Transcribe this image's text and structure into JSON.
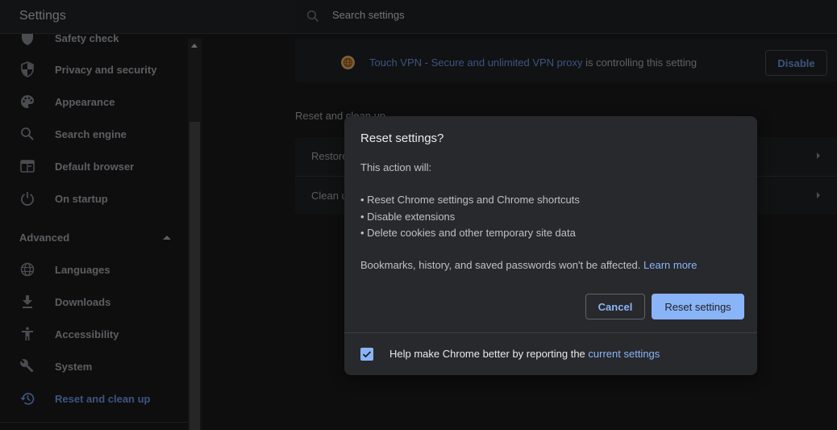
{
  "header": {
    "title": "Settings",
    "search_placeholder": "Search settings"
  },
  "sidebar": {
    "items": [
      {
        "label": "Safety check",
        "icon": "shield-check-icon"
      },
      {
        "label": "Privacy and security",
        "icon": "shield-icon"
      },
      {
        "label": "Appearance",
        "icon": "palette-icon"
      },
      {
        "label": "Search engine",
        "icon": "search-icon"
      },
      {
        "label": "Default browser",
        "icon": "browser-window-icon"
      },
      {
        "label": "On startup",
        "icon": "power-icon"
      }
    ],
    "advanced_label": "Advanced",
    "advanced_items": [
      {
        "label": "Languages",
        "icon": "globe-icon"
      },
      {
        "label": "Downloads",
        "icon": "download-icon"
      },
      {
        "label": "Accessibility",
        "icon": "accessibility-icon"
      },
      {
        "label": "System",
        "icon": "wrench-icon"
      },
      {
        "label": "Reset and clean up",
        "icon": "history-icon",
        "active": true
      }
    ]
  },
  "extension_banner": {
    "extension_name": "Touch VPN - Secure and unlimited VPN proxy",
    "message": " is controlling this setting",
    "disable_label": "Disable"
  },
  "reset_section": {
    "title": "Reset and clean up",
    "rows": [
      {
        "label": "Restore settings to their original defaults"
      },
      {
        "label": "Clean up computer"
      }
    ]
  },
  "dialog": {
    "title": "Reset settings?",
    "intro": "This action will:",
    "bullets": [
      "• Reset Chrome settings and Chrome shortcuts",
      "• Disable extensions",
      "• Delete cookies and other temporary site data"
    ],
    "note": "Bookmarks, history, and saved passwords won't be affected. ",
    "learn_more": "Learn more",
    "cancel_label": "Cancel",
    "reset_label": "Reset settings",
    "checkbox_checked": true,
    "checkbox_text": "Help make Chrome better by reporting the ",
    "checkbox_link": "current settings"
  },
  "colors": {
    "accent": "#8ab4f8",
    "dialog_bg": "#28292c",
    "page_bg": "#0e0e0f"
  }
}
